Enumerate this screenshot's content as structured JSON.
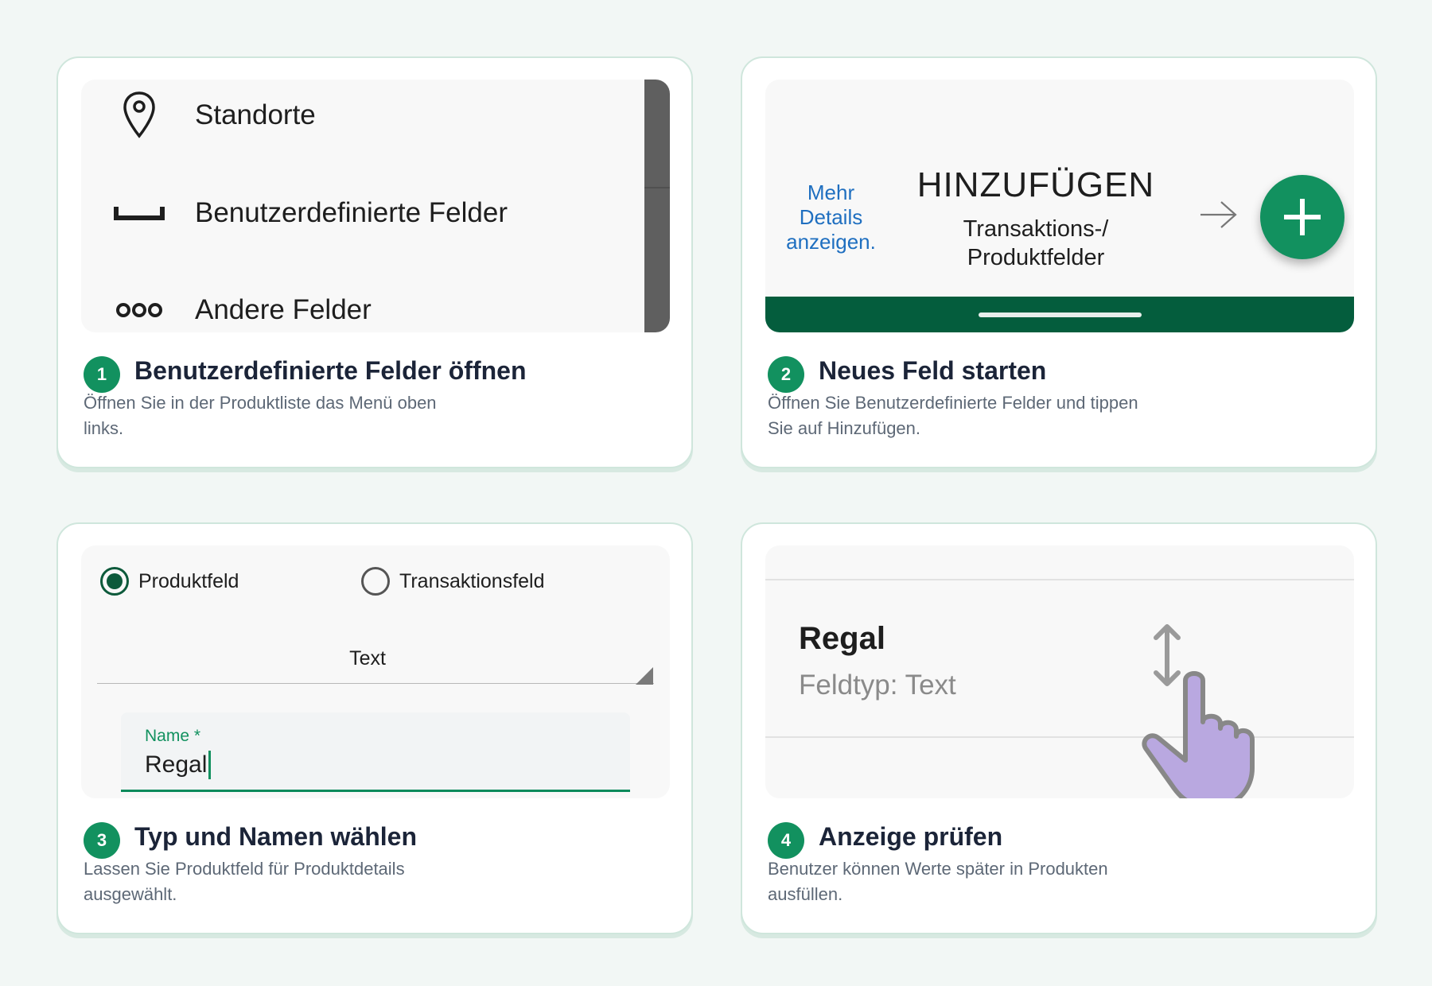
{
  "cards": [
    {
      "step": "1",
      "title": "Benutzerdefinierte Felder öffnen",
      "description": "Öffnen Sie in der Produktliste das Menü oben links.",
      "menu": [
        {
          "label": "Standorte",
          "icon": "location-pin-icon"
        },
        {
          "label": "Benutzerdefinierte Felder",
          "icon": "custom-fields-icon"
        },
        {
          "label": "Andere Felder",
          "icon": "other-fields-icon"
        }
      ]
    },
    {
      "step": "2",
      "title": "Neues Feld starten",
      "description": "Öffnen Sie Benutzerdefinierte Felder und tippen Sie auf Hinzufügen.",
      "more_link": "Mehr Details anzeigen.",
      "add_title": "HINZUFÜGEN",
      "add_subtitle": "Transaktions-/ Produktfelder"
    },
    {
      "step": "3",
      "title": "Typ und Namen wählen",
      "description": "Lassen Sie Produktfeld für Produktdetails ausgewählt.",
      "radio_product": "Produktfeld",
      "radio_transaction": "Transaktionsfeld",
      "selected_radio": "Produktfeld",
      "field_type": "Text",
      "name_label": "Name *",
      "name_value": "Regal"
    },
    {
      "step": "4",
      "title": "Anzeige prüfen",
      "description": "Benutzer können Werte später in Produkten ausfüllen.",
      "field_name": "Regal",
      "field_type_line": "Feldtyp: Text"
    }
  ],
  "colors": {
    "accent": "#12915f",
    "dark_green": "#045d3d",
    "link": "#1f6fc0",
    "hand": "#b9a8e0"
  }
}
